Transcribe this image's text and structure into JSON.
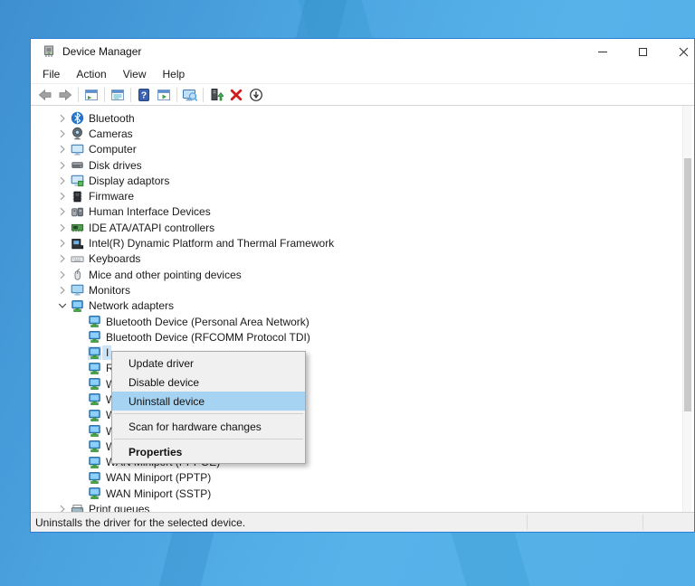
{
  "window": {
    "title": "Device Manager",
    "controls": [
      {
        "name": "minimize-button",
        "icon": "minimize-icon"
      },
      {
        "name": "maximize-button",
        "icon": "maximize-icon"
      },
      {
        "name": "close-button",
        "icon": "close-icon"
      }
    ]
  },
  "menu_bar": {
    "items": [
      {
        "label": "File"
      },
      {
        "label": "Action"
      },
      {
        "label": "View"
      },
      {
        "label": "Help"
      }
    ]
  },
  "toolbar": {
    "buttons": [
      {
        "icon": "back-icon",
        "name": "back-button"
      },
      {
        "icon": "forward-icon",
        "name": "forward-button"
      },
      {
        "sep": true
      },
      {
        "icon": "console-tree-icon",
        "name": "show-console-tree-button"
      },
      {
        "sep": true
      },
      {
        "icon": "properties-pane-icon",
        "name": "properties-button"
      },
      {
        "sep": true
      },
      {
        "icon": "help-icon",
        "name": "help-button"
      },
      {
        "icon": "action-pane-icon",
        "name": "action-pane-button"
      },
      {
        "sep": true
      },
      {
        "icon": "scan-hardware-icon",
        "name": "scan-hardware-changes-button"
      },
      {
        "sep": true
      },
      {
        "icon": "update-driver-icon",
        "name": "update-driver-button"
      },
      {
        "icon": "uninstall-icon",
        "name": "uninstall-device-button"
      },
      {
        "icon": "disable-icon",
        "name": "disable-device-button"
      }
    ]
  },
  "tree": {
    "items": [
      {
        "label": "Bluetooth",
        "icon": "bluetooth-icon",
        "level": 0,
        "chevron": "collapsed"
      },
      {
        "label": "Cameras",
        "icon": "camera-icon",
        "level": 0,
        "chevron": "collapsed"
      },
      {
        "label": "Computer",
        "icon": "computer-icon",
        "level": 0,
        "chevron": "collapsed"
      },
      {
        "label": "Disk drives",
        "icon": "disk-icon",
        "level": 0,
        "chevron": "collapsed"
      },
      {
        "label": "Display adaptors",
        "icon": "display-adapter-icon",
        "level": 0,
        "chevron": "collapsed"
      },
      {
        "label": "Firmware",
        "icon": "firmware-icon",
        "level": 0,
        "chevron": "collapsed"
      },
      {
        "label": "Human Interface Devices",
        "icon": "hid-icon",
        "level": 0,
        "chevron": "collapsed"
      },
      {
        "label": "IDE ATA/ATAPI controllers",
        "icon": "ide-icon",
        "level": 0,
        "chevron": "collapsed"
      },
      {
        "label": "Intel(R) Dynamic Platform and Thermal Framework",
        "icon": "intel-icon",
        "level": 0,
        "chevron": "collapsed"
      },
      {
        "label": "Keyboards",
        "icon": "keyboard-icon",
        "level": 0,
        "chevron": "collapsed"
      },
      {
        "label": "Mice and other pointing devices",
        "icon": "mouse-icon",
        "level": 0,
        "chevron": "collapsed"
      },
      {
        "label": "Monitors",
        "icon": "monitor-icon",
        "level": 0,
        "chevron": "collapsed"
      },
      {
        "label": "Network adapters",
        "icon": "network-adapter-icon",
        "level": 0,
        "chevron": "expanded"
      },
      {
        "label": "Bluetooth Device (Personal Area Network)",
        "icon": "network-adapter-icon",
        "level": 1
      },
      {
        "label": "Bluetooth Device (RFCOMM Protocol TDI)",
        "icon": "network-adapter-icon",
        "level": 1
      },
      {
        "label": "I",
        "icon": "network-adapter-icon",
        "level": 1,
        "selected": true
      },
      {
        "label": "R",
        "icon": "network-adapter-icon",
        "level": 1
      },
      {
        "label": "W",
        "icon": "network-adapter-icon",
        "level": 1
      },
      {
        "label": "W",
        "icon": "network-adapter-icon",
        "level": 1
      },
      {
        "label": "W",
        "icon": "network-adapter-icon",
        "level": 1
      },
      {
        "label": "W",
        "icon": "network-adapter-icon",
        "level": 1
      },
      {
        "label": "W",
        "icon": "network-adapter-icon",
        "level": 1
      },
      {
        "label": "WAN Miniport (PPPOE)",
        "icon": "network-adapter-icon",
        "level": 1
      },
      {
        "label": "WAN Miniport (PPTP)",
        "icon": "network-adapter-icon",
        "level": 1
      },
      {
        "label": "WAN Miniport (SSTP)",
        "icon": "network-adapter-icon",
        "level": 1
      },
      {
        "label": "Print queues",
        "icon": "printer-icon",
        "level": 0,
        "chevron": "collapsed"
      }
    ]
  },
  "context_menu": {
    "items": [
      {
        "label": "Update driver"
      },
      {
        "label": "Disable device"
      },
      {
        "label": "Uninstall device",
        "highlighted": true
      },
      {
        "separator": true
      },
      {
        "label": "Scan for hardware changes"
      },
      {
        "separator": true
      },
      {
        "label": "Properties",
        "bold": true
      }
    ]
  },
  "status_bar": {
    "text": "Uninstalls the driver for the selected device."
  },
  "colors": {
    "window_border": "#2a7fd4",
    "tree_selection": "#cce4f7",
    "menu_highlight": "#a6d3f1",
    "desktop_blue": "#54aee7",
    "uninstall_x_red": "#cf1b1b"
  }
}
